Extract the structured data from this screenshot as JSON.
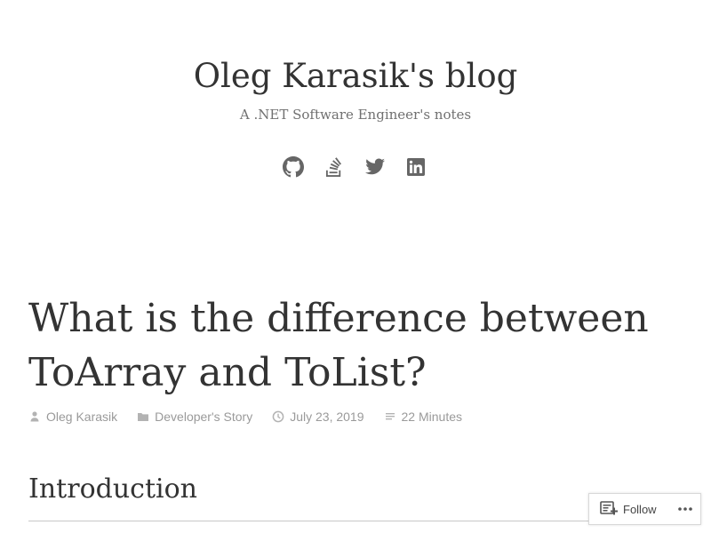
{
  "site": {
    "title": "Oleg Karasik's blog",
    "tagline": "A .NET Software Engineer's notes"
  },
  "social_links": [
    {
      "icon": "github-icon"
    },
    {
      "icon": "stackoverflow-icon"
    },
    {
      "icon": "twitter-icon"
    },
    {
      "icon": "linkedin-icon"
    }
  ],
  "post": {
    "title": "What is the difference between ToArray and ToList?",
    "meta": {
      "author": "Oleg Karasik",
      "category": "Developer's Story",
      "date": "July 23, 2019",
      "reading_time": "22 Minutes"
    },
    "section_heading": "Introduction"
  },
  "follow_widget": {
    "label": "Follow",
    "more_label": "•••"
  },
  "colors": {
    "text": "#333333",
    "muted": "#9a9a9a",
    "icon": "#666666",
    "background": "#ffffff"
  }
}
